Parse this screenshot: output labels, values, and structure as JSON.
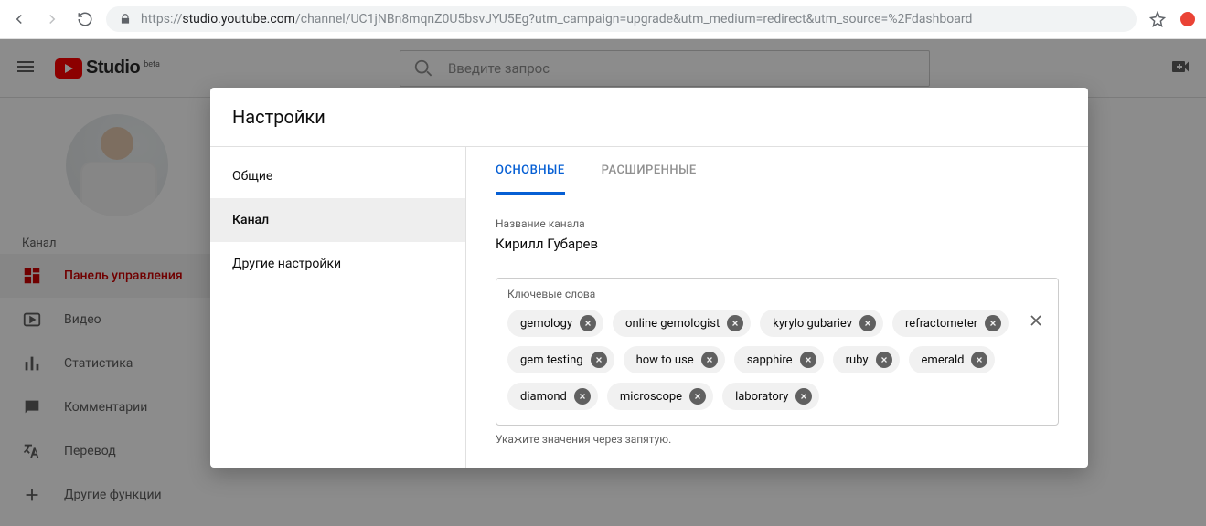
{
  "browser": {
    "url_scheme": "https://",
    "url_host": "studio.youtube.com",
    "url_path": "/channel/UC1jNBn8mqnZ0U5bsvJYU5Eg?utm_campaign=upgrade&utm_medium=redirect&utm_source=%2Fdashboard"
  },
  "header": {
    "logo_text": "Studio",
    "logo_beta": "beta",
    "search_placeholder": "Введите запрос"
  },
  "sidebar": {
    "channel_label": "Канал",
    "items": [
      {
        "label": "Панель управления"
      },
      {
        "label": "Видео"
      },
      {
        "label": "Статистика"
      },
      {
        "label": "Комментарии"
      },
      {
        "label": "Перевод"
      },
      {
        "label": "Другие функции"
      }
    ]
  },
  "modal": {
    "title": "Настройки",
    "side": [
      {
        "label": "Общие"
      },
      {
        "label": "Канал"
      },
      {
        "label": "Другие настройки"
      }
    ],
    "tabs": [
      {
        "label": "ОСНОВНЫЕ"
      },
      {
        "label": "РАСШИРЕННЫЕ"
      }
    ],
    "channel_name_label": "Название канала",
    "channel_name_value": "Кирилл Губарев",
    "keywords_label": "Ключевые слова",
    "keywords": [
      "gemology",
      "online gemologist",
      "kyrylo gubariev",
      "refractometer",
      "gem testing",
      "how to use",
      "sapphire",
      "ruby",
      "emerald",
      "diamond",
      "microscope",
      "laboratory"
    ],
    "keywords_helper": "Укажите значения через запятую."
  }
}
